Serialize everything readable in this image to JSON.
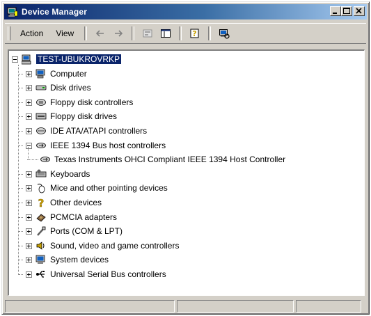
{
  "window": {
    "title": "Device Manager"
  },
  "menu": {
    "action": "Action",
    "view": "View"
  },
  "toolbar": [
    {
      "name": "back-arrow-icon"
    },
    {
      "name": "forward-arrow-icon"
    },
    {
      "name": "properties-icon"
    },
    {
      "name": "console-tree-icon"
    },
    {
      "name": "help-icon"
    },
    {
      "name": "scan-hardware-icon"
    }
  ],
  "tree": {
    "root": "TEST-UBUKROVRKP",
    "items": [
      {
        "label": "Computer",
        "icon": "computer-icon",
        "expanded": false
      },
      {
        "label": "Disk drives",
        "icon": "disk-drive-icon",
        "expanded": false
      },
      {
        "label": "Floppy disk controllers",
        "icon": "floppy-controller-icon",
        "expanded": false
      },
      {
        "label": "Floppy disk drives",
        "icon": "floppy-drive-icon",
        "expanded": false
      },
      {
        "label": "IDE ATA/ATAPI controllers",
        "icon": "ide-controller-icon",
        "expanded": false
      },
      {
        "label": "IEEE 1394 Bus host controllers",
        "icon": "ieee1394-icon",
        "expanded": true,
        "children": [
          {
            "label": "Texas Instruments OHCI Compliant IEEE 1394 Host Controller",
            "icon": "ieee1394-device-icon"
          }
        ]
      },
      {
        "label": "Keyboards",
        "icon": "keyboard-icon",
        "expanded": false
      },
      {
        "label": "Mice and other pointing devices",
        "icon": "mouse-icon",
        "expanded": false
      },
      {
        "label": "Other devices",
        "icon": "question-mark-icon",
        "expanded": false
      },
      {
        "label": "PCMCIA adapters",
        "icon": "pcmcia-icon",
        "expanded": false
      },
      {
        "label": "Ports (COM & LPT)",
        "icon": "port-icon",
        "expanded": false
      },
      {
        "label": "Sound, video and game controllers",
        "icon": "sound-icon",
        "expanded": false
      },
      {
        "label": "System devices",
        "icon": "system-devices-icon",
        "expanded": false
      },
      {
        "label": "Universal Serial Bus controllers",
        "icon": "usb-icon",
        "expanded": false
      }
    ]
  },
  "colors": {
    "titlebar": "#0a246a",
    "selection": "#0a246a",
    "face": "#d4d0c8"
  }
}
